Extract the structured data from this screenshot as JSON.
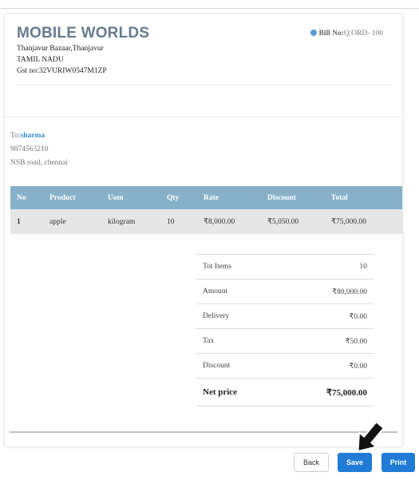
{
  "company": {
    "name": "MOBILE WORLDS",
    "address_line1": "Thanjavur Bazaar,Thanjavur",
    "address_line2": "TAMIL NADU",
    "gst": "Gst no:32VURIW0547M1ZP"
  },
  "bill": {
    "label": "Bill No:",
    "number": "Q.ORD- 100"
  },
  "customer": {
    "to_label": "To:",
    "name": "sharma",
    "phone": "9874563210",
    "address": "NSB road, chennai"
  },
  "table": {
    "headers": [
      "No",
      "Product",
      "Uom",
      "Qty",
      "Rate",
      "Discount",
      "Total"
    ],
    "rows": [
      [
        "1",
        "apple",
        "kilogram",
        "10",
        "₹8,000.00",
        "₹5,050.00",
        "₹75,000.00"
      ]
    ]
  },
  "totals": [
    {
      "label": "Tot Items",
      "value": "10"
    },
    {
      "label": "Amount",
      "value": "₹80,000.00"
    },
    {
      "label": "Delivery",
      "value": "₹0.00"
    },
    {
      "label": "Tax",
      "value": "₹50.00"
    },
    {
      "label": "Discount",
      "value": "₹0.00"
    }
  ],
  "net": {
    "label": "Net price",
    "value": "₹75,000.00"
  },
  "buttons": {
    "back": "Back",
    "save": "Save",
    "print": "Print"
  },
  "colors": {
    "accent": "#1f7bd6",
    "table_header": "#87b1c9",
    "company_name": "#6b7a8f",
    "customer_name": "#3a8cc9"
  },
  "icons": {
    "bill_dot": "dot-icon",
    "cursor": "arrow-cursor-icon"
  }
}
